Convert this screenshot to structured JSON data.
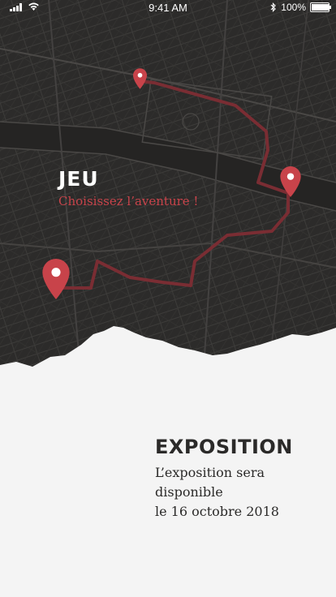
{
  "status_bar": {
    "time": "9:41 AM",
    "battery": "100%",
    "icons": [
      "signal-icon",
      "wifi-icon",
      "bluetooth-icon",
      "battery-icon"
    ]
  },
  "game": {
    "title": "JEU",
    "subtitle": "Choisissez l’aventure !"
  },
  "exposition": {
    "title": "EXPOSITION",
    "lines": [
      "L’exposition sera",
      "disponible",
      "le 16 octobre 2018"
    ]
  },
  "colors": {
    "map_background": "#2a2928",
    "accent_red": "#c8434a",
    "paper": "#f4f4f4",
    "text_dark": "#2b2a29"
  }
}
